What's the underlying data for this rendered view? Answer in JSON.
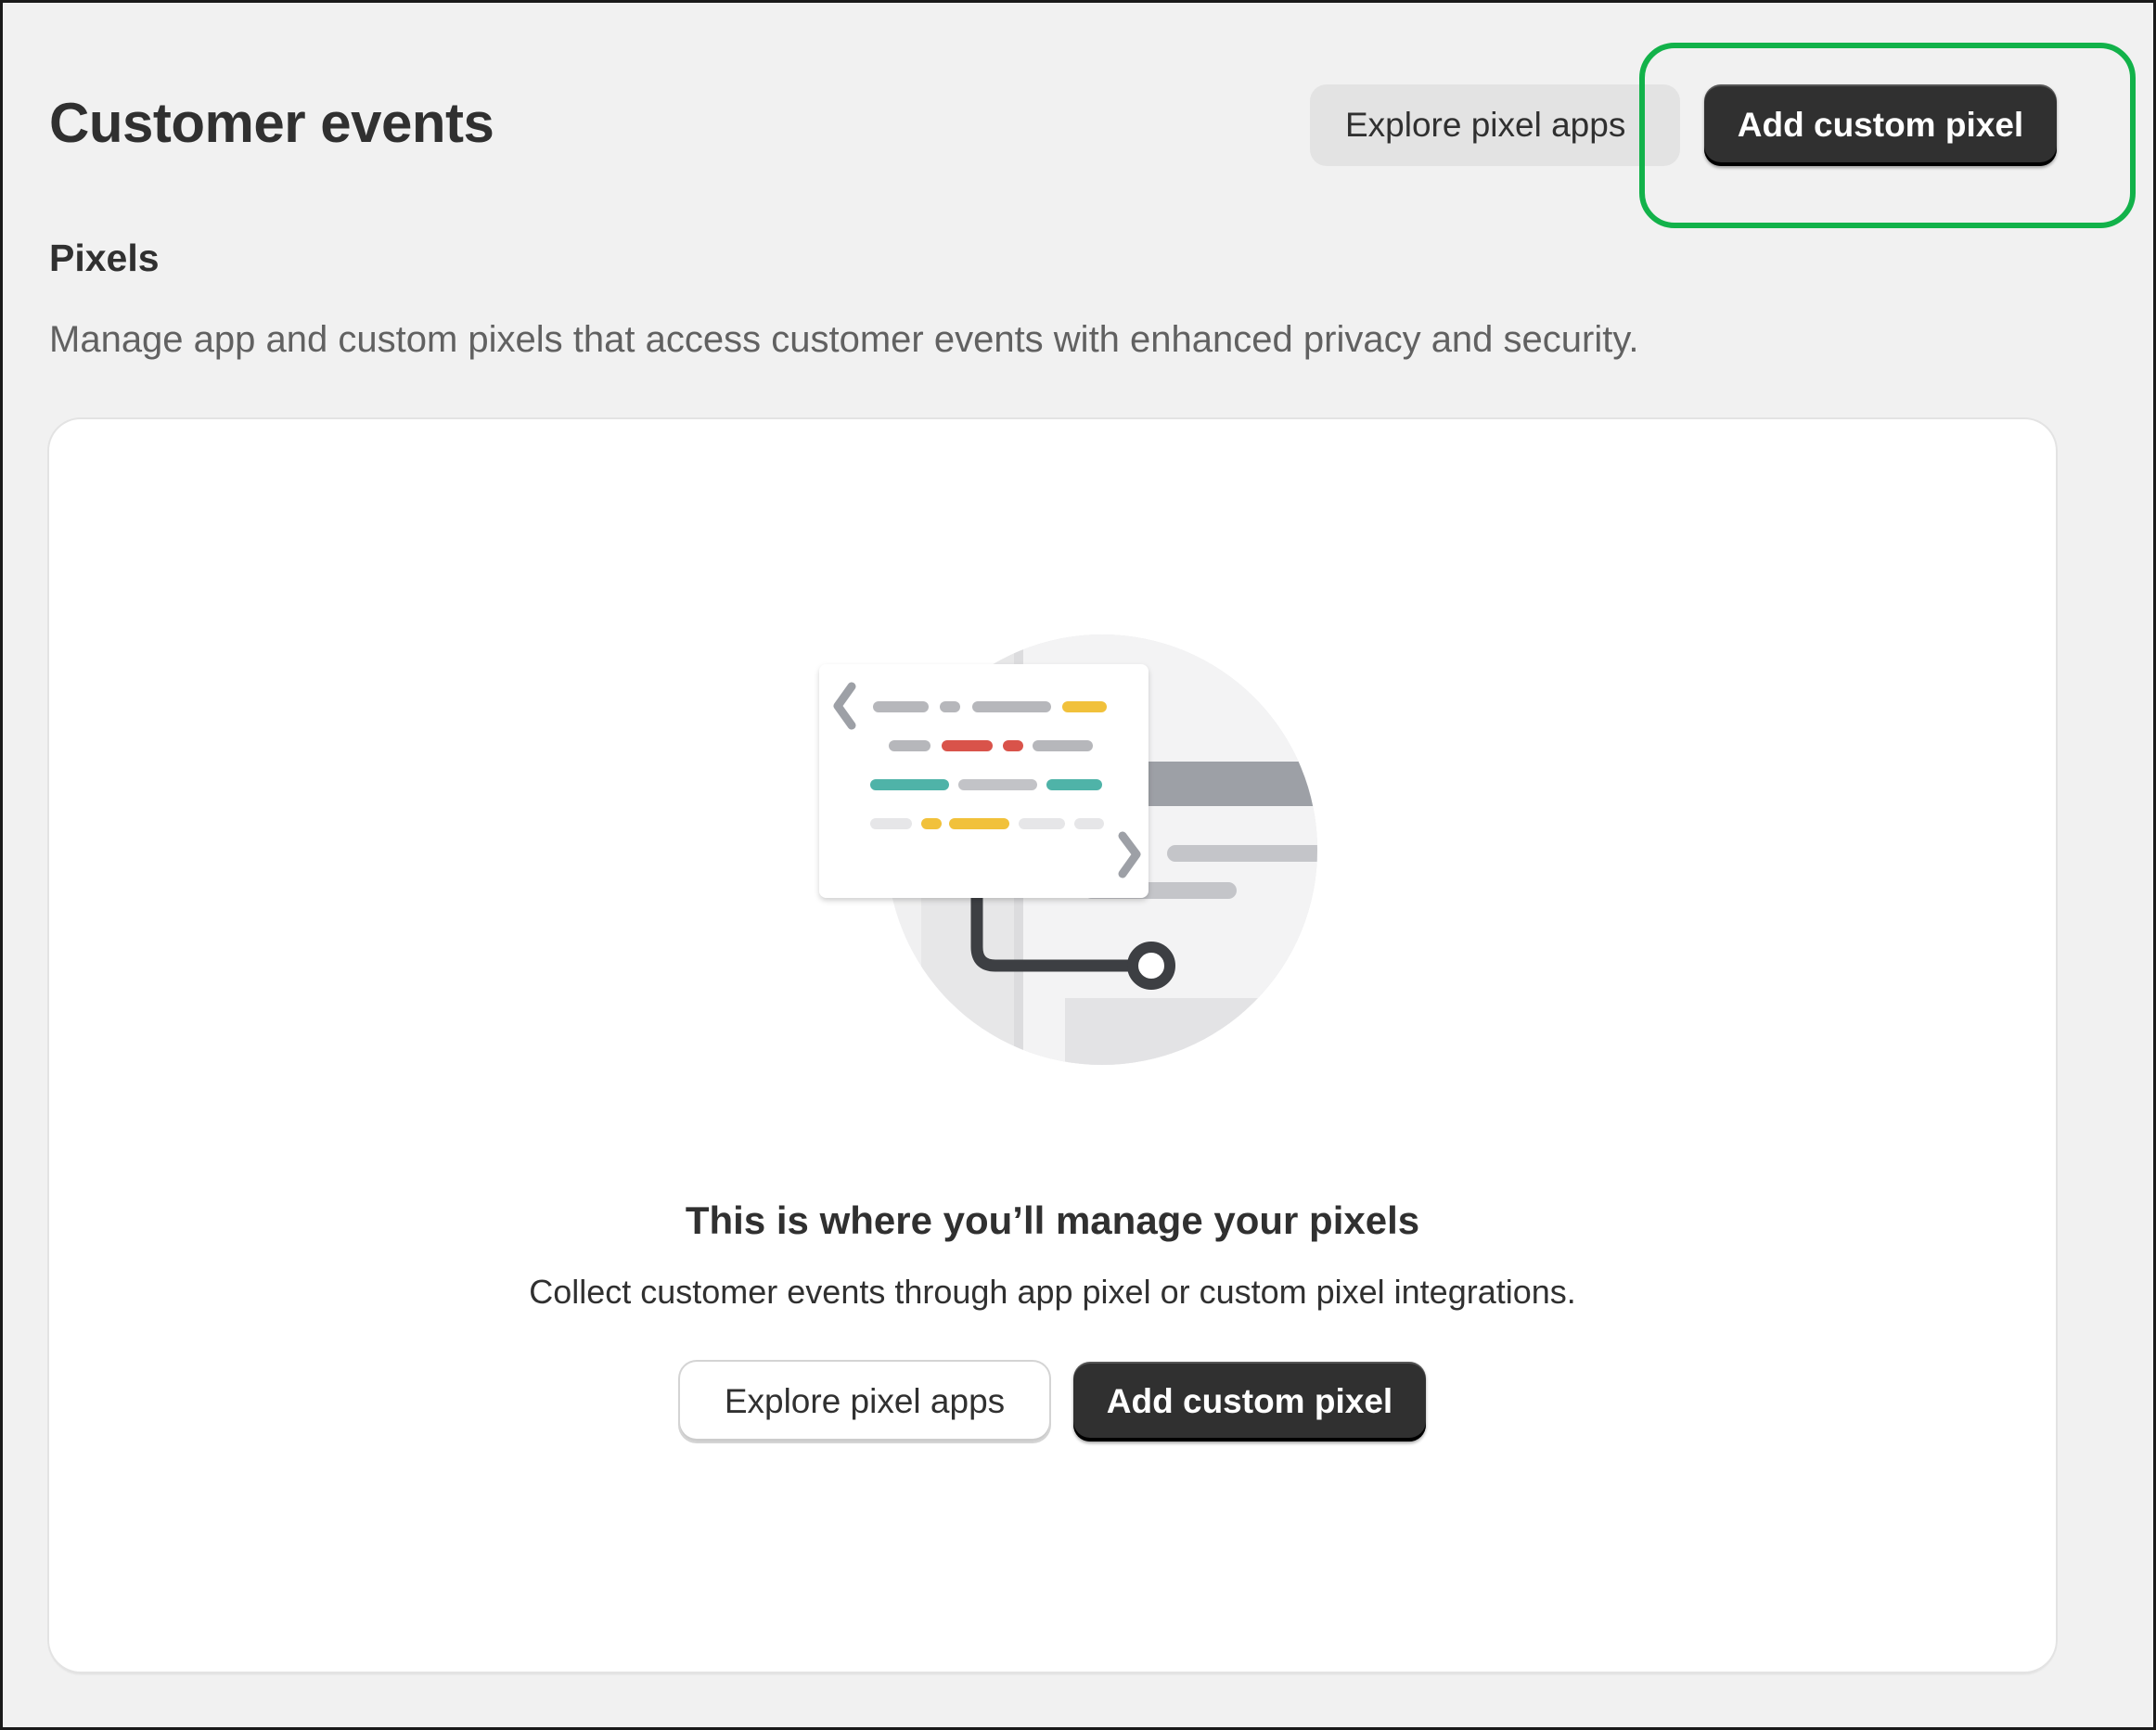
{
  "header": {
    "title": "Customer events",
    "explore_button_label": "Explore pixel apps",
    "add_button_label": "Add custom pixel"
  },
  "section": {
    "title": "Pixels",
    "description": "Manage app and custom pixels that access customer events with enhanced privacy and security."
  },
  "empty_state": {
    "illustration_icon": "code-pixel-illustration",
    "title": "This is where you’ll manage your pixels",
    "description": "Collect customer events through app pixel or custom pixel integrations.",
    "explore_button_label": "Explore pixel apps",
    "add_button_label": "Add custom pixel"
  },
  "colors": {
    "highlight": "#12b24a",
    "primary_button": "#303030",
    "page_background": "#f1f1f1"
  }
}
